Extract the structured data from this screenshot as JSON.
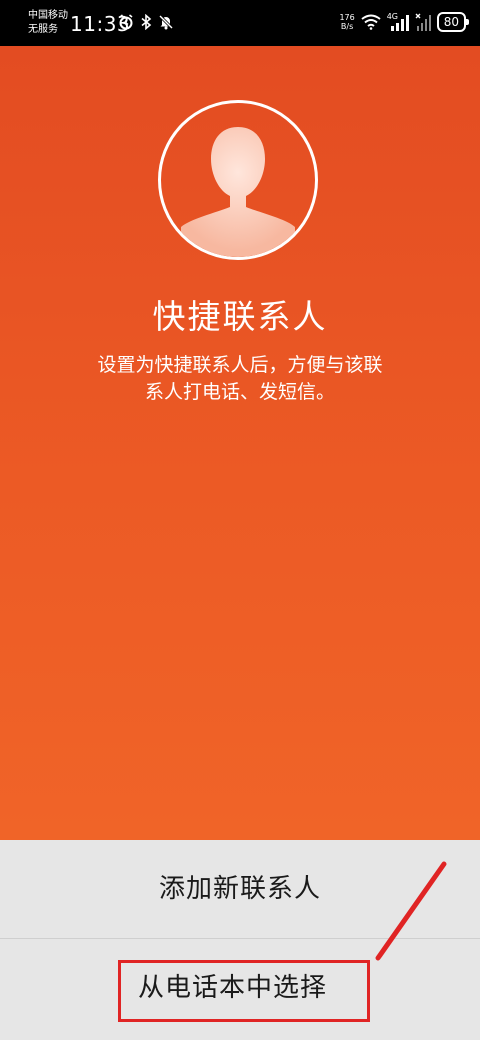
{
  "status_bar": {
    "carrier_line1": "中国移动",
    "carrier_line2": "无服务",
    "time": "11:33",
    "net_speed_value": "176",
    "net_speed_unit": "B/s",
    "network_type": "4G",
    "battery": "80",
    "icons": [
      "alarm-icon",
      "bluetooth-icon",
      "mute-icon",
      "wifi-icon",
      "signal-icon",
      "no-signal-icon"
    ]
  },
  "hero": {
    "title": "快捷联系人",
    "description": "设置为快捷联系人后，方便与该联系人打电话、发短信。",
    "colors": {
      "top": "#e34c22",
      "bottom": "#f06428"
    }
  },
  "sheet": {
    "option_add": "添加新联系人",
    "option_pick": "从电话本中选择",
    "annotation_color": "#e02424"
  }
}
